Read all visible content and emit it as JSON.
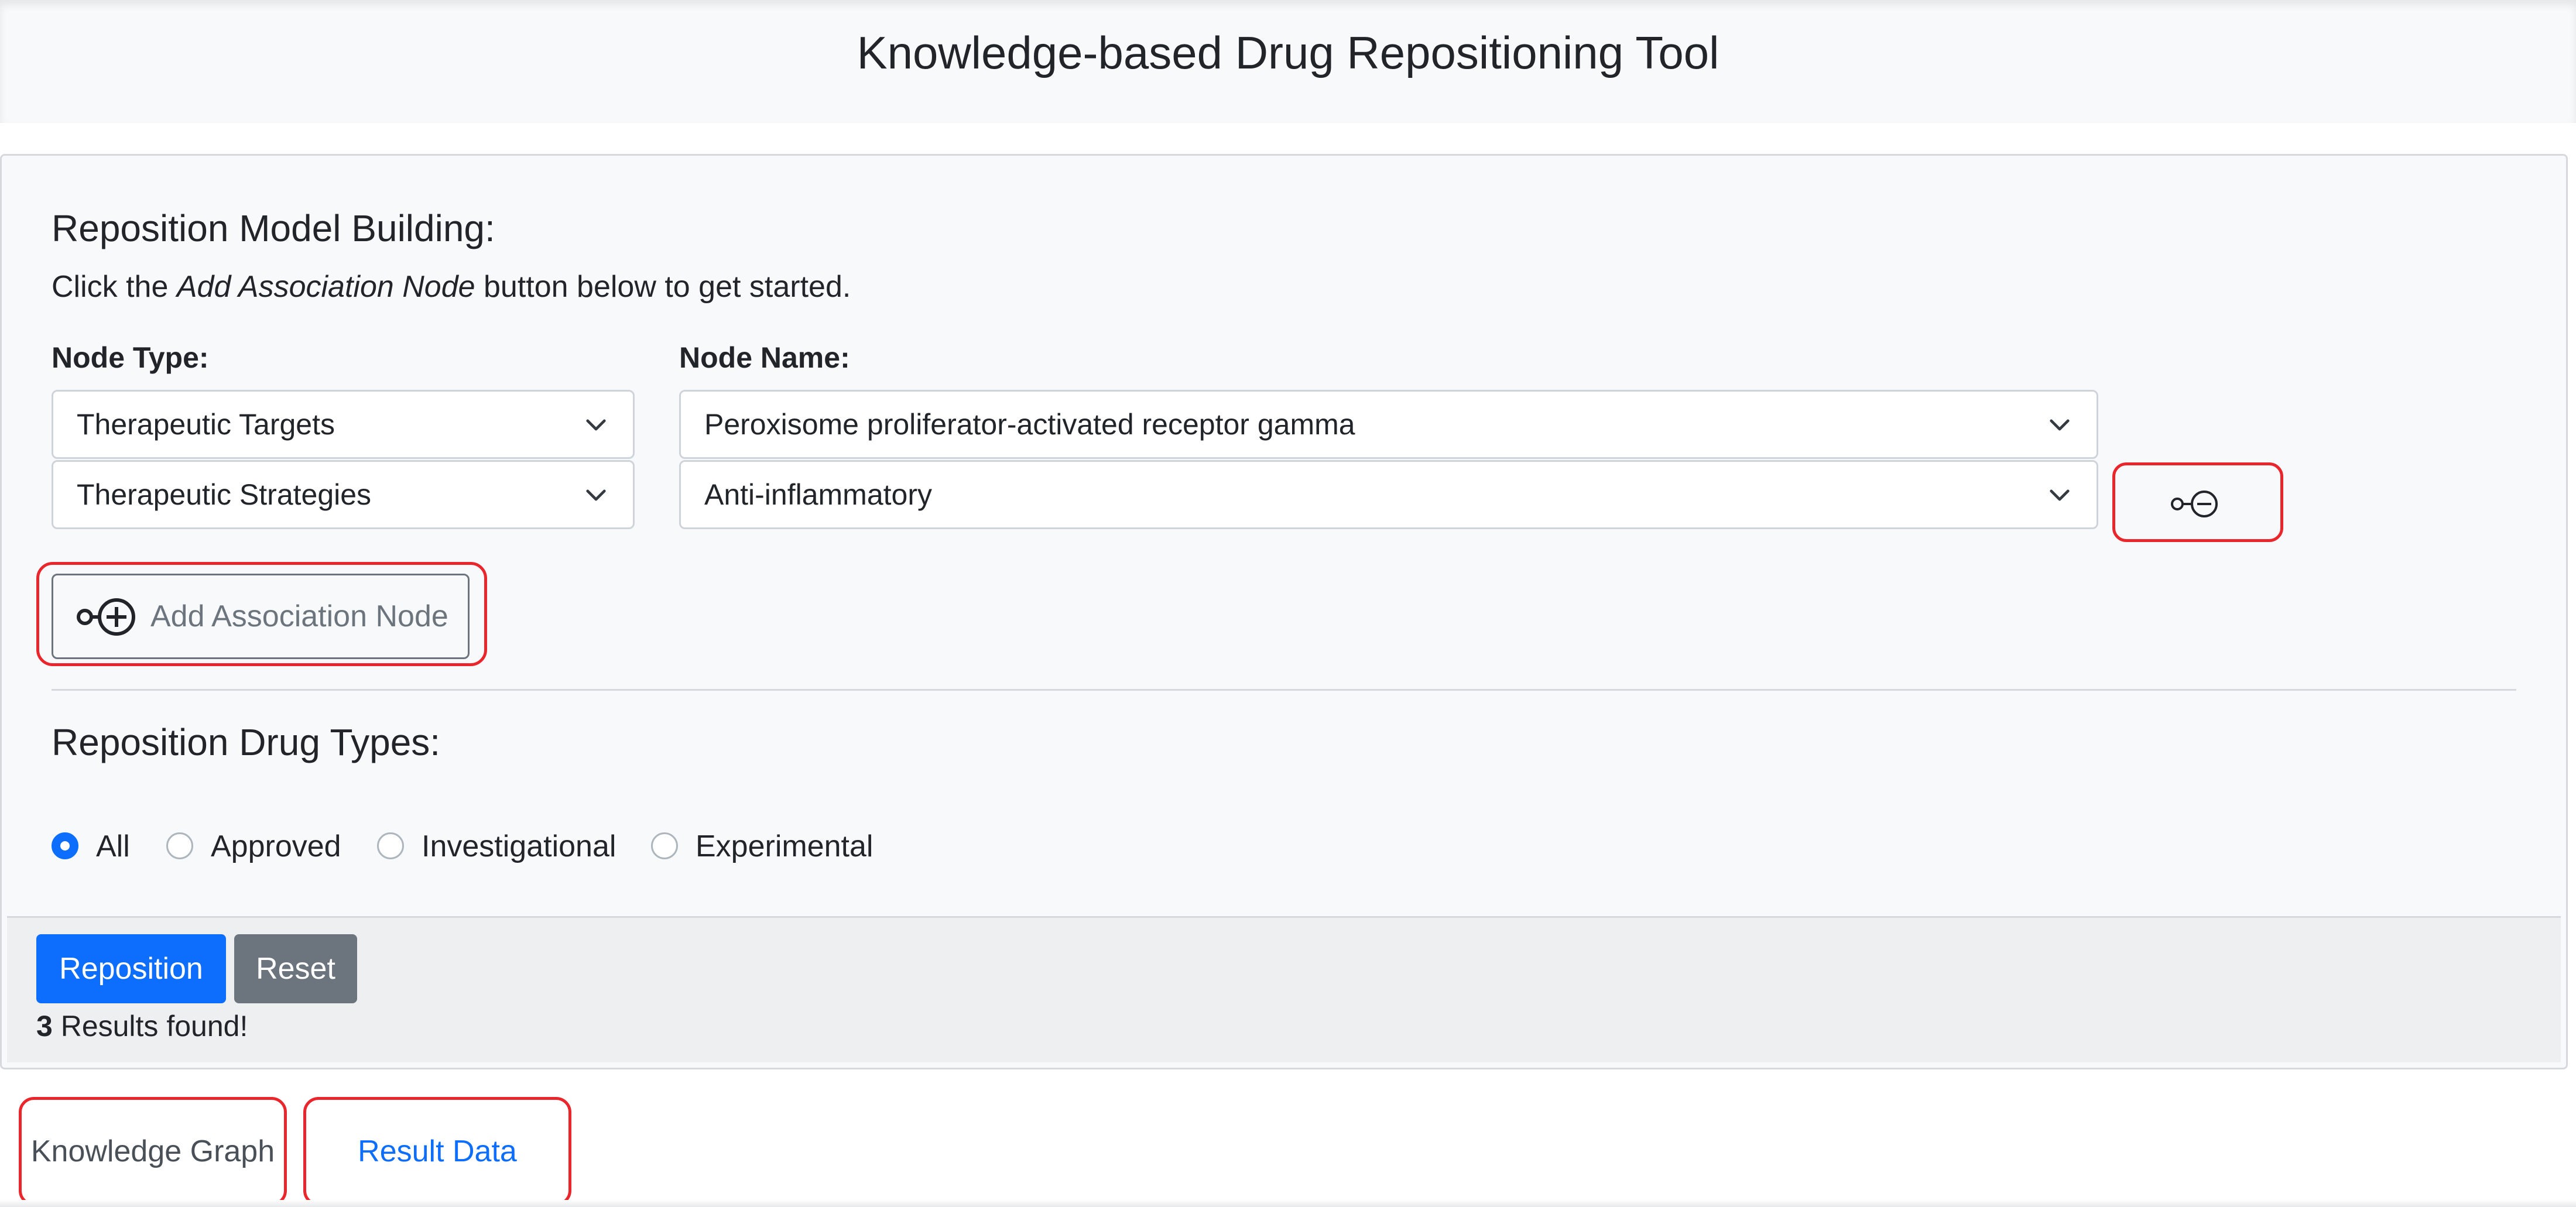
{
  "header": {
    "title": "Knowledge-based Drug Repositioning Tool"
  },
  "model_building": {
    "title": "Reposition Model Building:",
    "intro_prefix": "Click the ",
    "intro_emphasis": "Add Association Node",
    "intro_suffix": " button below to get started.",
    "node_type_label": "Node Type:",
    "node_name_label": "Node Name:",
    "rows": [
      {
        "node_type": "Therapeutic Targets",
        "node_name": "Peroxisome proliferator-activated receptor gamma"
      },
      {
        "node_type": "Therapeutic Strategies",
        "node_name": "Anti-inflammatory"
      }
    ],
    "add_button_label": "Add Association Node",
    "add_button_icon": "node-plus-icon",
    "remove_button_icon": "node-minus-icon"
  },
  "drug_types": {
    "title": "Reposition Drug Types:",
    "options": [
      "All",
      "Approved",
      "Investigational",
      "Experimental"
    ],
    "selected": "All"
  },
  "footer": {
    "reposition_label": "Reposition",
    "reset_label": "Reset",
    "results_count": "3",
    "results_suffix": " Results found!"
  },
  "tabs": {
    "knowledge_graph": "Knowledge Graph",
    "result_data": "Result Data",
    "active": "Knowledge Graph"
  },
  "colors": {
    "primary": "#0d6efd",
    "secondary": "#6c757d",
    "highlight": "#e8262b"
  }
}
